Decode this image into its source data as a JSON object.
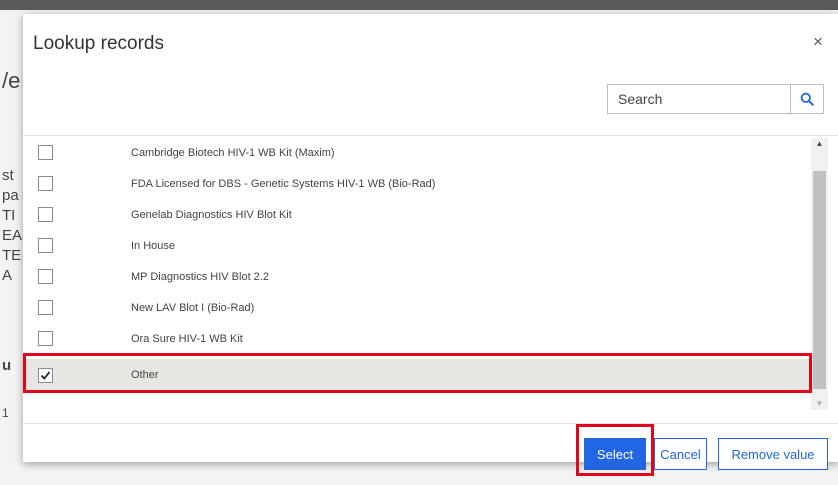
{
  "background": {
    "fragments": [
      "/e",
      "st",
      "pa",
      "TI",
      "EA",
      "TE",
      "A",
      "u",
      "1"
    ]
  },
  "dialog": {
    "title": "Lookup records",
    "close_glyph": "×"
  },
  "search": {
    "placeholder": "Search",
    "icon": "search-icon"
  },
  "records": [
    {
      "label": "Cambridge Biotech HIV-1 WB Kit (Maxim)",
      "checked": false
    },
    {
      "label": "FDA Licensed for DBS - Genetic Systems HIV-1 WB (Bio-Rad)",
      "checked": false
    },
    {
      "label": "Genelab Diagnostics HIV Blot Kit",
      "checked": false
    },
    {
      "label": "In House",
      "checked": false
    },
    {
      "label": "MP Diagnostics HIV Blot 2.2",
      "checked": false
    },
    {
      "label": "New LAV Blot I (Bio-Rad)",
      "checked": false
    },
    {
      "label": "Ora Sure HIV-1 WB Kit",
      "checked": false
    },
    {
      "label": "Other",
      "checked": true,
      "selected": true
    }
  ],
  "buttons": {
    "select": "Select",
    "cancel": "Cancel",
    "remove": "Remove value"
  },
  "colors": {
    "accent": "#2266e3",
    "highlight": "#e2061a",
    "selected_row": "#e8e6e3"
  }
}
